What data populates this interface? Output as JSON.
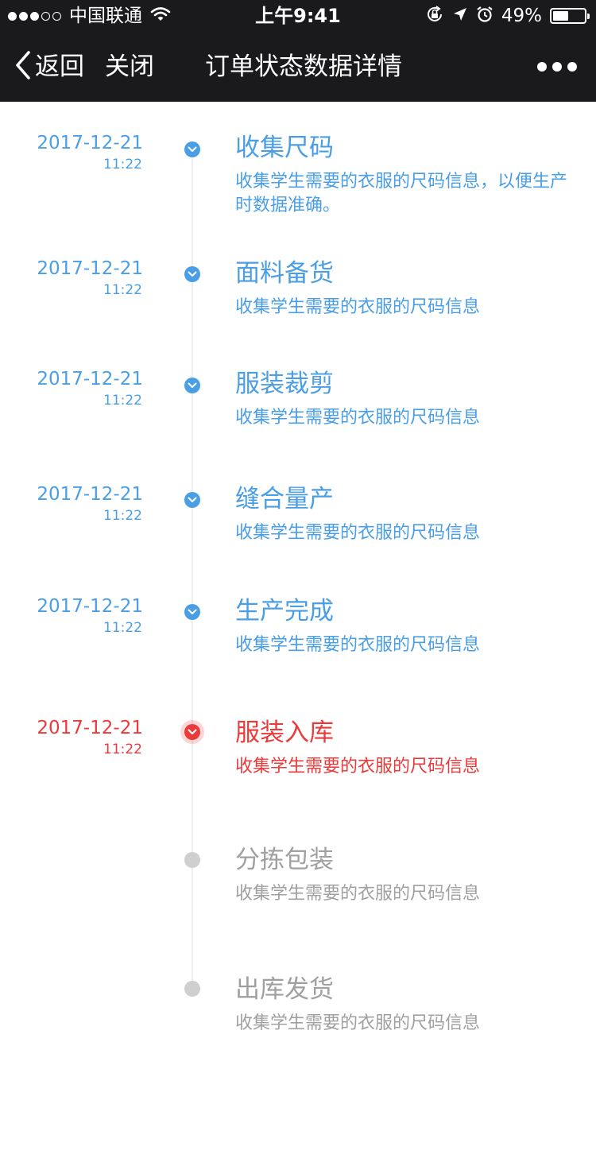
{
  "status_bar": {
    "carrier": "中国联通",
    "time": "上午9:41",
    "battery": "49%",
    "battery_level": 0.49
  },
  "nav": {
    "back_label": "返回",
    "close_label": "关闭",
    "title": "订单状态数据详情"
  },
  "colors": {
    "done": "#4a9ee6",
    "current": "#ea3a3a",
    "pending": "#cfcfcf"
  },
  "steps": [
    {
      "date": "2017-12-21",
      "time": "11:22",
      "title": "收集尺码",
      "desc": "收集学生需要的衣服的尺码信息，以便生产时数据准确。",
      "state": "done"
    },
    {
      "date": "2017-12-21",
      "time": "11:22",
      "title": "面料备货",
      "desc": "收集学生需要的衣服的尺码信息",
      "state": "done"
    },
    {
      "date": "2017-12-21",
      "time": "11:22",
      "title": "服装裁剪",
      "desc": "收集学生需要的衣服的尺码信息",
      "state": "done"
    },
    {
      "date": "2017-12-21",
      "time": "11:22",
      "title": "缝合量产",
      "desc": "收集学生需要的衣服的尺码信息",
      "state": "done"
    },
    {
      "date": "2017-12-21",
      "time": "11:22",
      "title": "生产完成",
      "desc": "收集学生需要的衣服的尺码信息",
      "state": "done"
    },
    {
      "date": "2017-12-21",
      "time": "11:22",
      "title": "服装入库",
      "desc": "收集学生需要的衣服的尺码信息",
      "state": "current"
    },
    {
      "date": "",
      "time": "",
      "title": "分拣包装",
      "desc": "收集学生需要的衣服的尺码信息",
      "state": "pending"
    },
    {
      "date": "",
      "time": "",
      "title": "出库发货",
      "desc": "收集学生需要的衣服的尺码信息",
      "state": "pending"
    }
  ]
}
